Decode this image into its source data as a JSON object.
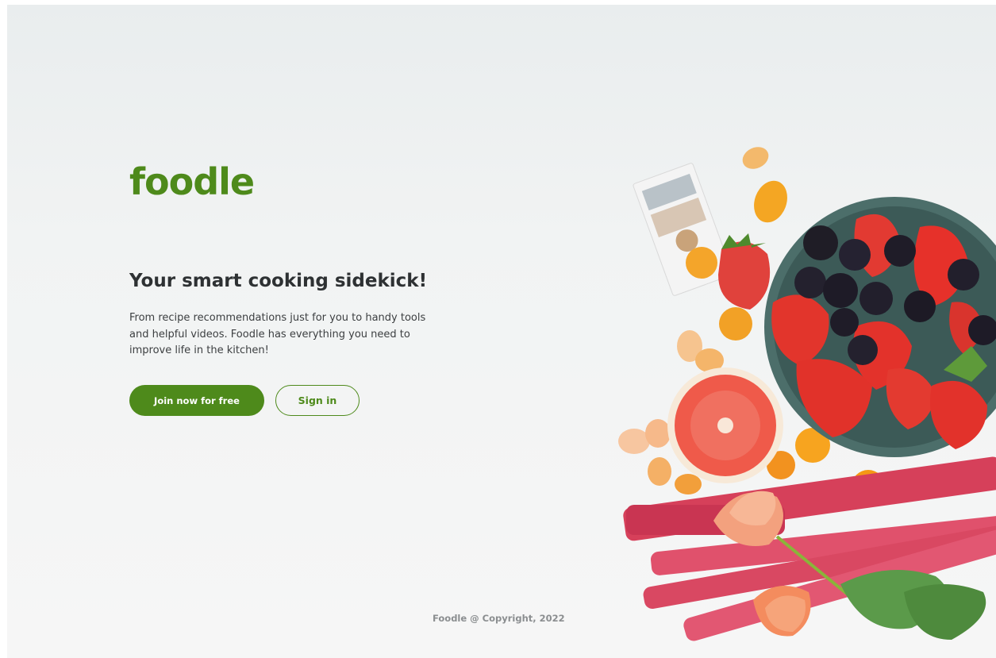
{
  "brand": {
    "logo_text": "foodle"
  },
  "hero": {
    "headline": "Your smart cooking sidekick!",
    "description": "From recipe recommendations just for you to handy tools and helpful videos. Foodle has everything you need to improve life in the kitchen!",
    "image_icon": "fruit-bowl-illustration"
  },
  "actions": {
    "join_label": "Join now for free",
    "signin_label": "Sign in"
  },
  "footer": {
    "copyright": "Foodle @ Copyright, 2022"
  },
  "colors": {
    "brand_green": "#4e8a1b",
    "heading": "#2e3133",
    "body_text": "#3c3f41",
    "footer_text": "#8b8e90"
  }
}
